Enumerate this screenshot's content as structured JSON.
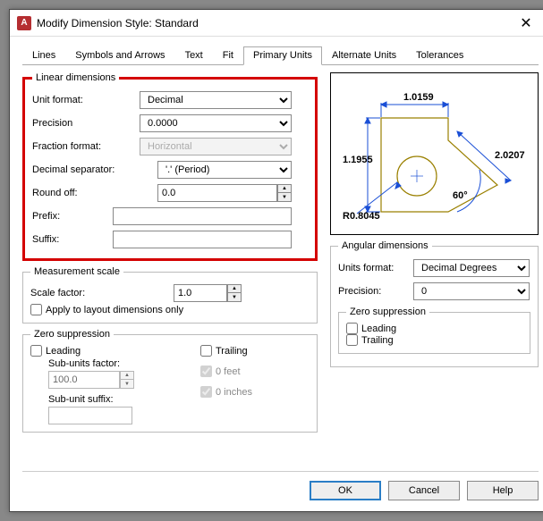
{
  "title": "Modify Dimension Style: Standard",
  "tabs": [
    "Lines",
    "Symbols and Arrows",
    "Text",
    "Fit",
    "Primary Units",
    "Alternate Units",
    "Tolerances"
  ],
  "activeTab": "Primary Units",
  "linear": {
    "legend": "Linear dimensions",
    "unitFormatLabel": "Unit format:",
    "unitFormat": "Decimal",
    "precisionLabel": "Precision",
    "precision": "0.0000",
    "fractionFormatLabel": "Fraction format:",
    "fractionFormat": "Horizontal",
    "decimalSepLabel": "Decimal separator:",
    "decimalSep": "'.' (Period)",
    "roundOffLabel": "Round off:",
    "roundOff": "0.0",
    "prefixLabel": "Prefix:",
    "prefix": "",
    "suffixLabel": "Suffix:",
    "suffix": ""
  },
  "measurement": {
    "legend": "Measurement scale",
    "scaleFactorLabel": "Scale factor:",
    "scaleFactor": "1.0",
    "applyLayoutLabel": "Apply to layout dimensions only"
  },
  "zero": {
    "legend": "Zero suppression",
    "leadingLabel": "Leading",
    "trailingLabel": "Trailing",
    "subUnitsFactorLabel": "Sub-units factor:",
    "subUnitsFactor": "100.0",
    "subUnitSuffixLabel": "Sub-unit suffix:",
    "subUnitSuffix": "",
    "feetLabel": "0 feet",
    "inchesLabel": "0 inches"
  },
  "angular": {
    "legend": "Angular dimensions",
    "unitsFormatLabel": "Units format:",
    "unitsFormat": "Decimal Degrees",
    "precisionLabel": "Precision:",
    "precision": "0",
    "zeroLegend": "Zero suppression",
    "leadingLabel": "Leading",
    "trailingLabel": "Trailing"
  },
  "preview": {
    "d1": "1.0159",
    "d2": "1.1955",
    "d3": "2.0207",
    "ang": "60°",
    "rad": "R0.8045"
  },
  "buttons": {
    "ok": "OK",
    "cancel": "Cancel",
    "help": "Help"
  }
}
